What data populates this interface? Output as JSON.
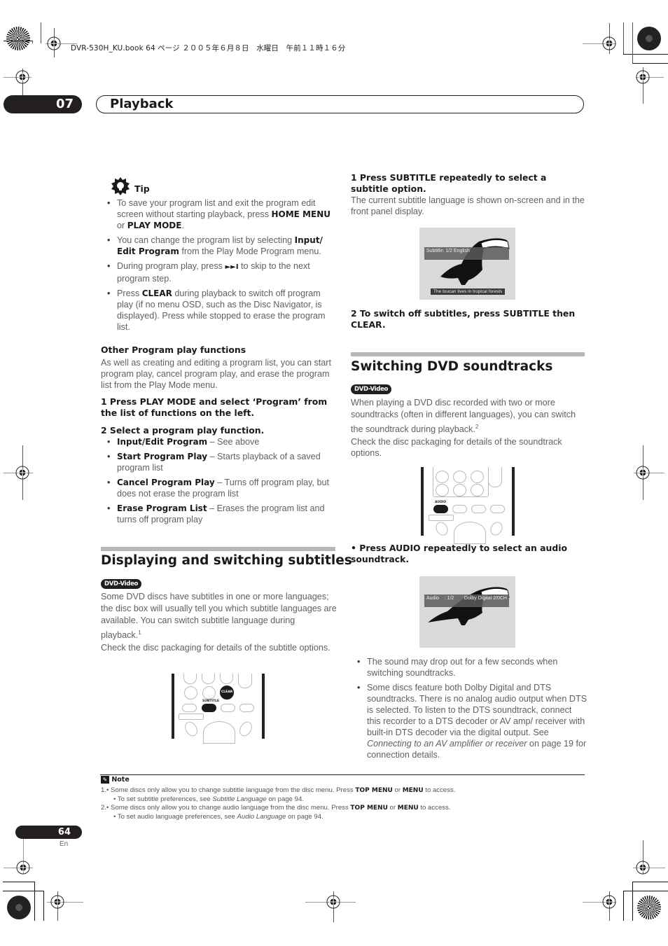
{
  "print_header": "DVR-530H_KU.book  64 ページ  ２００５年６月８日　水曜日　午前１１時１６分",
  "chapter": {
    "number": "07",
    "title": "Playback"
  },
  "tip": {
    "label": "Tip",
    "items": [
      {
        "pre": "To save your program list and exit the program edit screen without starting playback, press ",
        "b1": "HOME MENU",
        "mid": " or ",
        "b2": "PLAY MODE",
        "post": "."
      },
      {
        "pre": "You can change the program list by selecting ",
        "b1": "Input/ Edit Program",
        "post": " from the Play Mode Program menu."
      },
      {
        "pre": "During program play, press ",
        "sym": "►►I",
        "post": " to skip to the next program step."
      },
      {
        "pre": "Press ",
        "b1": "CLEAR",
        "post": " during playback to switch off program play (if no menu OSD, such as the Disc Navigator, is displayed). Press while stopped to erase the program list."
      }
    ]
  },
  "other_functions": {
    "heading": "Other Program play functions",
    "intro": "As well as creating and editing a program list, you can start program play, cancel program play, and erase the program list from the Play Mode menu.",
    "step1": "1    Press PLAY MODE and select ‘Program’ from the list of functions on the left.",
    "step2": "2    Select a program play function.",
    "functions": [
      {
        "name": "Input/Edit Program",
        "desc": " – See above"
      },
      {
        "name": "Start Program Play",
        "desc": " – Starts playback of a saved program list"
      },
      {
        "name": "Cancel Program Play",
        "desc": " – Turns off program play, but does not erase the program list"
      },
      {
        "name": "Erase Program List",
        "desc": " – Erases the program list and turns off program play"
      }
    ]
  },
  "subtitles": {
    "title": "Displaying and switching subtitles",
    "badge": "DVD-Video",
    "para1": "Some DVD discs have subtitles in one or more languages; the disc box will usually tell you which subtitle languages are available. You can switch subtitle language during playback.",
    "para1_sup": "1",
    "para2": "Check the disc packaging for details of the subtitle options.",
    "remote_labels": {
      "clear": "CLEAR",
      "subtitle": "SUBTITLE"
    },
    "step1": "1    Press SUBTITLE repeatedly to select a subtitle option.",
    "step1_desc": "The current subtitle language is shown on-screen and in the front panel display.",
    "osd": "Subtitle: 1/2 English",
    "caption": "The toucan lives in tropical forests",
    "step2": "2    To switch off subtitles, press SUBTITLE then CLEAR."
  },
  "soundtracks": {
    "title": "Switching DVD soundtracks",
    "badge": "DVD-Video",
    "para1": "When playing a DVD disc recorded with two or more soundtracks (often in different languages), you can switch the soundtrack during playback.",
    "para1_sup": "2",
    "para2": "Check the disc packaging for details of the soundtrack options.",
    "remote_labels": {
      "audio": "AUDIO"
    },
    "step": "•    Press AUDIO repeatedly to select an audio soundtrack.",
    "osd_left": "Audio    : 1/2",
    "osd_right": "Dolby Digital 2/0CH",
    "bullets": [
      {
        "text": "The sound may drop out for a few seconds when switching soundtracks."
      },
      {
        "pre": "Some discs feature both Dolby Digital and DTS soundtracks. There is no analog audio output when DTS is selected. To listen to the DTS soundtrack, connect this recorder to a DTS decoder or AV amp/ receiver with built-in DTS decoder via the digital output. See ",
        "em": "Connecting to an AV amplifier or receiver",
        "post": " on page 19 for connection details."
      }
    ]
  },
  "notes": {
    "label": "Note",
    "items": [
      {
        "n": "1.",
        "a_pre": "• Some discs only allow you to change subtitle language from the disc menu. Press ",
        "b1": "TOP MENU",
        "mid": " or ",
        "b2": "MENU",
        "a_post": " to access.",
        "b_pre": "• To set subtitle preferences, see ",
        "em": "Subtitle Language",
        "b_post": " on page 94."
      },
      {
        "n": "2.",
        "a_pre": "• Some discs only allow you to change audio language from the disc menu. Press ",
        "b1": "TOP MENU",
        "mid": " or ",
        "b2": "MENU",
        "a_post": " to access.",
        "b_pre": "• To set audio language preferences, see ",
        "em": "Audio Language",
        "b_post": " on page 94."
      }
    ]
  },
  "footer": {
    "page": "64",
    "lang": "En"
  }
}
